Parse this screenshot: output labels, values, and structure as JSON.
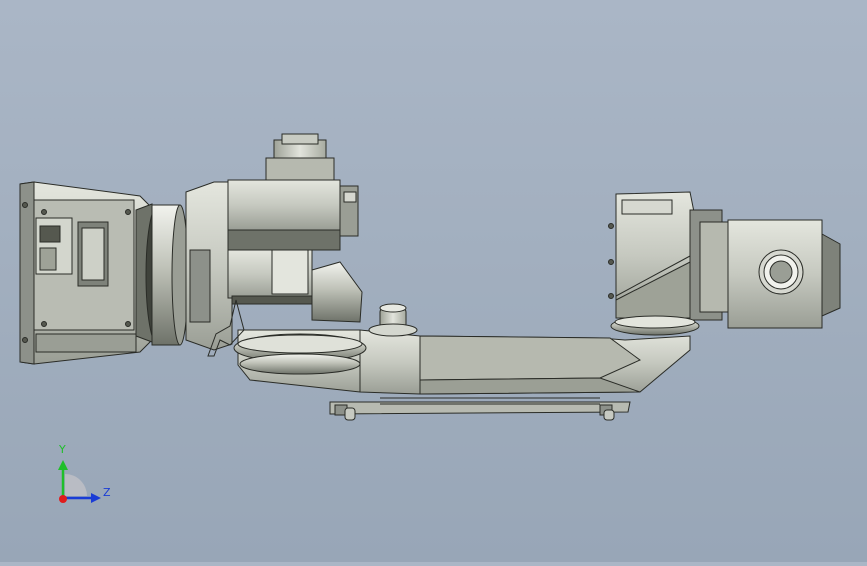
{
  "triad": {
    "y_label": "Y",
    "z_label": "Z",
    "y_color": "#1fbf2a",
    "z_color": "#1a3cd6",
    "x_color": "#e01c1c"
  },
  "model": {
    "body_color": "#c9ccc3",
    "shade_color": "#8d918a",
    "dark_color": "#55584f",
    "edge_color": "#2a2c27"
  }
}
